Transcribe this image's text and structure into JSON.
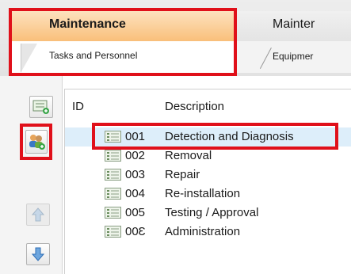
{
  "tabs": [
    {
      "title": "Maintenance",
      "subtitle": "Tasks and Personnel"
    },
    {
      "title": "Mainter",
      "subtitle": "Equipmer"
    }
  ],
  "table": {
    "columns": [
      "ID",
      "Description"
    ],
    "rows": [
      {
        "id": "001",
        "description": "Detection and Diagnosis"
      },
      {
        "id": "002",
        "description": "Removal"
      },
      {
        "id": "003",
        "description": "Repair"
      },
      {
        "id": "004",
        "description": "Re-installation"
      },
      {
        "id": "005",
        "description": "Testing / Approval"
      },
      {
        "id": "00Ɛ",
        "description": "Administration"
      }
    ]
  },
  "toolbar": [
    {
      "icon": "add-task-icon",
      "state": "enabled"
    },
    {
      "icon": "add-personnel-icon",
      "state": "enabled"
    },
    {
      "icon": "move-up-icon",
      "state": "disabled"
    },
    {
      "icon": "move-down-icon",
      "state": "enabled"
    }
  ],
  "highlight_color": "#e0101a",
  "active_tab_color": "#f9bf7a",
  "selected_row_color": "#ddeefa"
}
